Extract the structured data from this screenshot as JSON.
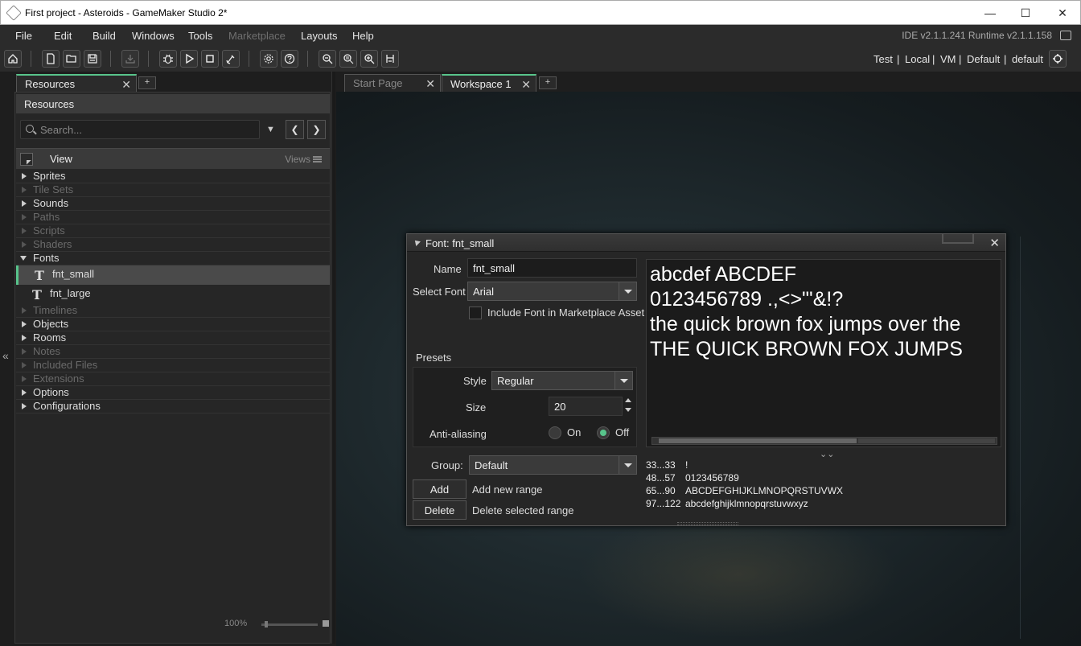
{
  "window": {
    "title": "First project - Asteroids - GameMaker Studio 2*",
    "minimize": "—",
    "maximize": "☐",
    "close": "✕"
  },
  "menu": {
    "items": [
      "File",
      "Edit",
      "Build",
      "Windows",
      "Tools",
      "Marketplace",
      "Layouts",
      "Help"
    ],
    "ide_version": "IDE v2.1.1.241 Runtime v2.1.1.158"
  },
  "toolbar": {
    "target": [
      "Test",
      "Local",
      "VM",
      "Default",
      "default"
    ],
    "separator": "|"
  },
  "left_tabs": {
    "active": "Resources",
    "add": "+"
  },
  "resources": {
    "header": "Resources",
    "search_placeholder": "Search...",
    "view_label": "View",
    "views_label": "Views",
    "tree": [
      {
        "label": "Sprites",
        "enabled": true
      },
      {
        "label": "Tile Sets",
        "enabled": false
      },
      {
        "label": "Sounds",
        "enabled": true
      },
      {
        "label": "Paths",
        "enabled": false
      },
      {
        "label": "Scripts",
        "enabled": false
      },
      {
        "label": "Shaders",
        "enabled": false
      },
      {
        "label": "Fonts",
        "enabled": true,
        "open": true
      },
      {
        "label": "Timelines",
        "enabled": false
      },
      {
        "label": "Objects",
        "enabled": true
      },
      {
        "label": "Rooms",
        "enabled": true
      },
      {
        "label": "Notes",
        "enabled": false
      },
      {
        "label": "Included Files",
        "enabled": false
      },
      {
        "label": "Extensions",
        "enabled": false
      },
      {
        "label": "Options",
        "enabled": true
      },
      {
        "label": "Configurations",
        "enabled": true
      }
    ],
    "fonts_children": [
      "fnt_small",
      "fnt_large"
    ],
    "zoom": "100%"
  },
  "right_tabs": {
    "start_page": "Start Page",
    "workspace": "Workspace 1",
    "add": "+"
  },
  "font_editor": {
    "title": "Font: fnt_small",
    "name_label": "Name",
    "name_value": "fnt_small",
    "select_font_label": "Select Font",
    "font_value": "Arial",
    "include_label": "Include Font in Marketplace Asset",
    "presets_label": "Presets",
    "style_label": "Style",
    "style_value": "Regular",
    "size_label": "Size",
    "size_value": "20",
    "aa_label": "Anti-aliasing",
    "on_label": "On",
    "off_label": "Off",
    "preview_lines": [
      "abcdef ABCDEF",
      "0123456789 .,<>\"'&!?",
      "the quick brown fox jumps over the",
      "THE QUICK BROWN FOX JUMPS"
    ],
    "group_label": "Group:",
    "group_value": "Default",
    "add_button": "Add",
    "add_desc": "Add new range",
    "delete_button": "Delete",
    "delete_desc": "Delete selected range",
    "ranges": [
      {
        "range": "33...33",
        "chars": "!"
      },
      {
        "range": "48...57",
        "chars": "0123456789"
      },
      {
        "range": "65...90",
        "chars": "ABCDEFGHIJKLMNOPQRSTUVWX"
      },
      {
        "range": "97...122",
        "chars": "abcdefghijklmnopqrstuvwxyz"
      }
    ]
  }
}
